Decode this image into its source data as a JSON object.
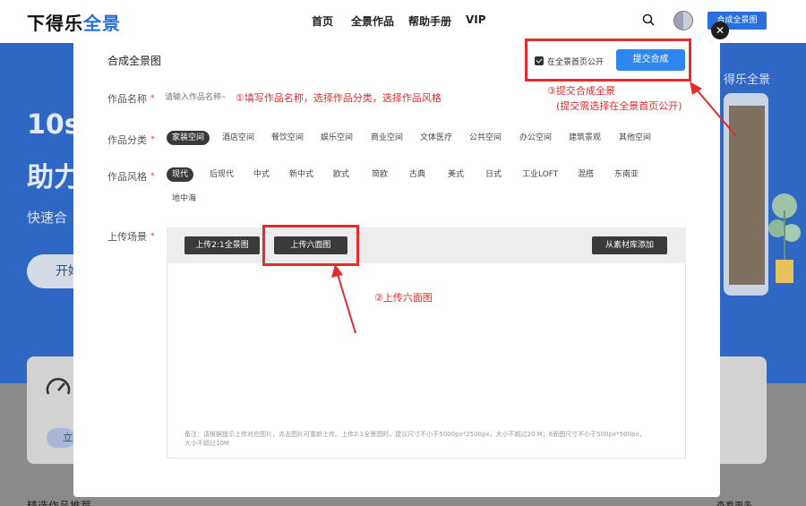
{
  "header": {
    "logo_main": "下得乐",
    "logo_accent": "全景",
    "nav": [
      "首页",
      "全景作品",
      "帮助手册",
      "VIP"
    ],
    "cta": "合成全景图"
  },
  "hero": {
    "line1": "10s",
    "line2": "助力",
    "sub": "快速合",
    "button": "开始",
    "right_text": "得乐全景",
    "pill": "立",
    "bottom_left": "精选作品推荐",
    "bottom_right": "查看更多"
  },
  "modal": {
    "title": "合成全景图",
    "close": "✕",
    "publish_label": "在全景首页公开",
    "publish_checked": true,
    "submit": "提交合成",
    "name_label": "作品名称",
    "name_placeholder": "请输入作品名称~",
    "category_label": "作品分类",
    "categories": [
      "家装空间",
      "酒店空间",
      "餐饮空间",
      "娱乐空间",
      "商业空间",
      "文体医疗",
      "公共空间",
      "办公空间",
      "建筑景观",
      "其他空间"
    ],
    "category_selected": "家装空间",
    "style_label": "作品风格",
    "styles": [
      "现代",
      "后现代",
      "中式",
      "新中式",
      "欧式",
      "简欧",
      "古典",
      "美式",
      "日式",
      "工业LOFT",
      "混搭",
      "东南亚",
      "地中海"
    ],
    "style_selected": "现代",
    "scene_label": "上传场景",
    "required_mark": "*",
    "upload_panorama": "上传2:1全景图",
    "upload_cube": "上传六面图",
    "from_library": "从素材库添加",
    "note": "备注：请根据提示上传对应图片，点击图片可重新上传。上传2:1全景图时，建议尺寸不小于5000px*2500px，大小不超过20 M；6面图尺寸不小于500px*500px，大小不超过10M"
  },
  "annotations": {
    "step1": "①填写作品名称，选择作品分类，选择作品风格",
    "step2": "②上传六面图",
    "step3_line1": "③提交合成全景",
    "step3_line2": "(提交需选择在全景首页公开)",
    "color": "#e52b2b"
  },
  "colors": {
    "brand": "#2a6fdb",
    "submit": "#2f86f0",
    "chip_selected": "#3a3a3a"
  }
}
